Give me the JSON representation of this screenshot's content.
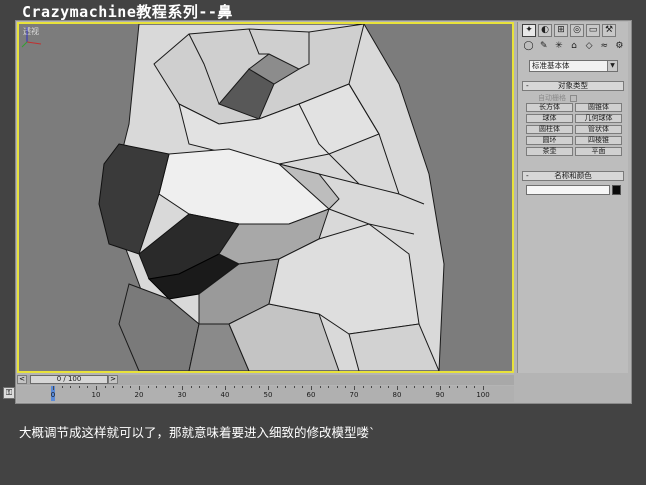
{
  "title": "Crazymachine教程系列--鼻",
  "viewport": {
    "label": "透视"
  },
  "command_panel": {
    "tabs": [
      "create-icon",
      "modify-icon",
      "hierarchy-icon",
      "motion-icon",
      "display-icon",
      "utilities-icon"
    ],
    "subtabs": [
      "geometry-icon",
      "shapes-icon",
      "lights-icon",
      "cameras-icon",
      "helpers-icon",
      "spacewarps-icon",
      "systems-icon"
    ],
    "dropdown_value": "标准基本体",
    "object_type": {
      "header": "对象类型",
      "autogrid_label": "自动栅格",
      "buttons": [
        "长方体",
        "圆锥体",
        "球体",
        "几何球体",
        "圆柱体",
        "管状体",
        "圆环",
        "四棱锥",
        "茶壶",
        "平面"
      ]
    },
    "name_color": {
      "header": "名称和颜色",
      "name_value": "",
      "color": "#0a0a0a"
    }
  },
  "time_slider": {
    "value": "0 / 100",
    "prev_label": "<",
    "next_label": ">"
  },
  "track_bar": {
    "ticks": [
      0,
      10,
      20,
      30,
      40,
      50,
      60,
      70,
      80,
      90,
      100
    ]
  },
  "caption": "大概调节成这样就可以了，那就意味着要进入细致的修改模型喽`",
  "colors": {
    "viewport_border": "#e8e23a",
    "background": "#434343"
  }
}
